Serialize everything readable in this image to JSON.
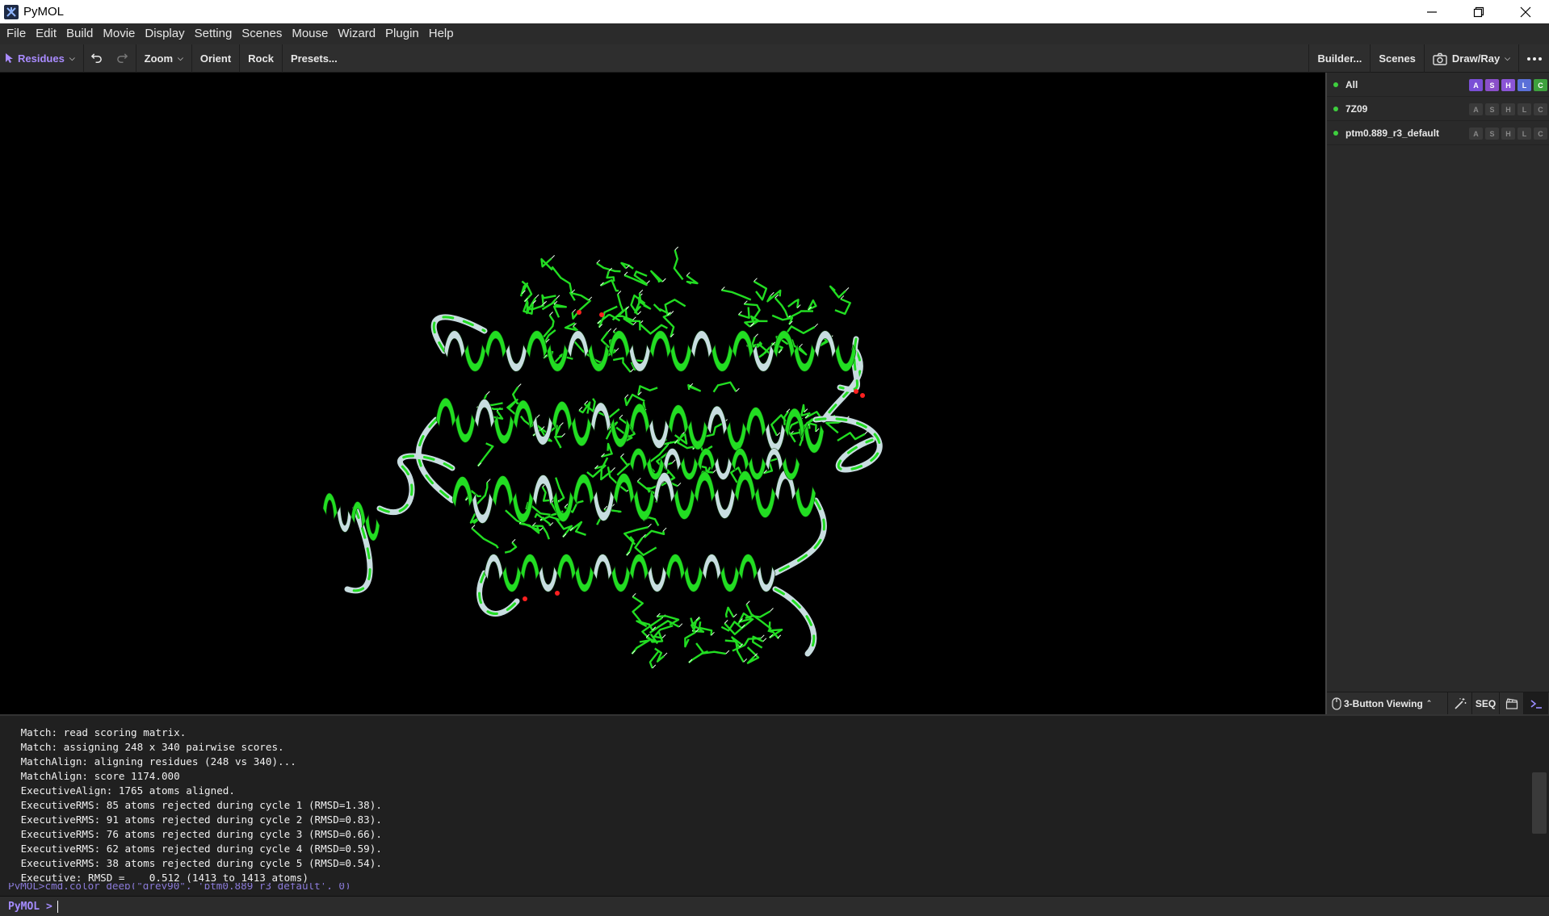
{
  "window": {
    "title": "PyMOL"
  },
  "menu": [
    "File",
    "Edit",
    "Build",
    "Movie",
    "Display",
    "Setting",
    "Scenes",
    "Mouse",
    "Wizard",
    "Plugin",
    "Help"
  ],
  "toolbar": {
    "selection_mode": "Residues",
    "zoom": "Zoom",
    "orient": "Orient",
    "rock": "Rock",
    "presets": "Presets...",
    "builder": "Builder...",
    "scenes": "Scenes",
    "draw_ray": "Draw/Ray"
  },
  "objects": [
    {
      "name": "All",
      "buttons": [
        "A",
        "S",
        "H",
        "L",
        "C"
      ],
      "active_colored": true
    },
    {
      "name": "7Z09",
      "buttons": [
        "A",
        "S",
        "H",
        "L",
        "C"
      ],
      "active_colored": false
    },
    {
      "name": "ptm0.889_r3_default",
      "buttons": [
        "A",
        "S",
        "H",
        "L",
        "C"
      ],
      "active_colored": false
    }
  ],
  "panel_bottom": {
    "viewing_mode": "3-Button Viewing",
    "seq": "SEQ"
  },
  "console": {
    "lines": [
      " Match: read scoring matrix.",
      " Match: assigning 248 x 340 pairwise scores.",
      " MatchAlign: aligning residues (248 vs 340)...",
      " MatchAlign: score 1174.000",
      " ExecutiveAlign: 1765 atoms aligned.",
      " ExecutiveRMS: 85 atoms rejected during cycle 1 (RMSD=1.38).",
      " ExecutiveRMS: 91 atoms rejected during cycle 2 (RMSD=0.83).",
      " ExecutiveRMS: 76 atoms rejected during cycle 3 (RMSD=0.66).",
      " ExecutiveRMS: 62 atoms rejected during cycle 4 (RMSD=0.59).",
      " ExecutiveRMS: 38 atoms rejected during cycle 5 (RMSD=0.54).",
      " Executive: RMSD =    0.512 (1413 to 1413 atoms)"
    ],
    "partial_line": "PyMOL>cmd.color_deep(\"grey90\", 'ptm0.889_r3_default', 0)",
    "prompt": "PyMOL >"
  },
  "colors": {
    "accent": "#a98bff",
    "helix_green": "#22dd22",
    "helix_white": "#c8dde0",
    "oxygen": "#ff2020"
  }
}
